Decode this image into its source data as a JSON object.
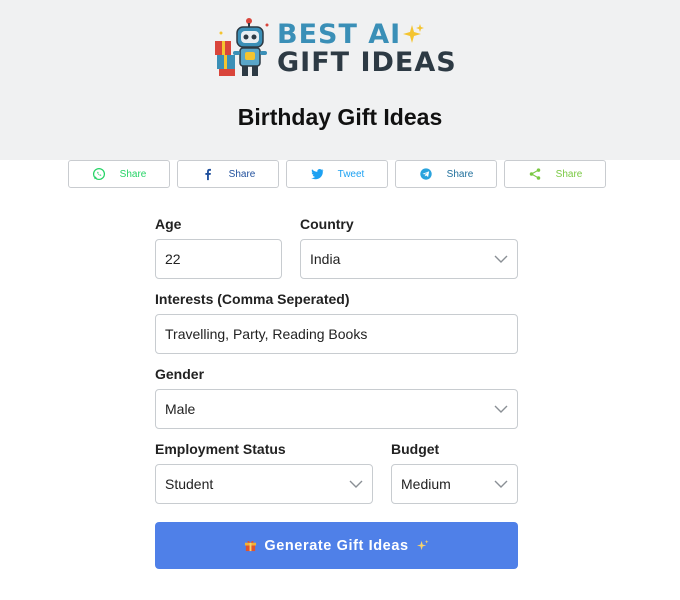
{
  "logo": {
    "line1": "BEST AI",
    "line2": "GIFT IDEAS",
    "sparkle_color": "#f4c430",
    "brand_blue": "#3a8fb7"
  },
  "page": {
    "title": "Birthday Gift Ideas"
  },
  "share": [
    {
      "label": "Share",
      "icon": "whatsapp-icon",
      "color": "#25d366"
    },
    {
      "label": "Share",
      "icon": "facebook-icon",
      "color": "#1877f2"
    },
    {
      "label": "Tweet",
      "icon": "twitter-icon",
      "color": "#1da1f2"
    },
    {
      "label": "Share",
      "icon": "telegram-icon",
      "color": "#2aa3dd"
    },
    {
      "label": "Share",
      "icon": "share-icon",
      "color": "#7ac943"
    }
  ],
  "form": {
    "age": {
      "label": "Age",
      "value": "22"
    },
    "country": {
      "label": "Country",
      "value": "India"
    },
    "interests": {
      "label": "Interests (Comma Seperated)",
      "value": "Travelling, Party, Reading Books"
    },
    "gender": {
      "label": "Gender",
      "value": "Male"
    },
    "employment": {
      "label": "Employment Status",
      "value": "Student"
    },
    "budget": {
      "label": "Budget",
      "value": "Medium"
    },
    "submit": {
      "label": "Generate Gift Ideas",
      "icon_left": "gift-icon",
      "icon_right": "sparkles-icon",
      "color": "#4f80e8"
    }
  }
}
